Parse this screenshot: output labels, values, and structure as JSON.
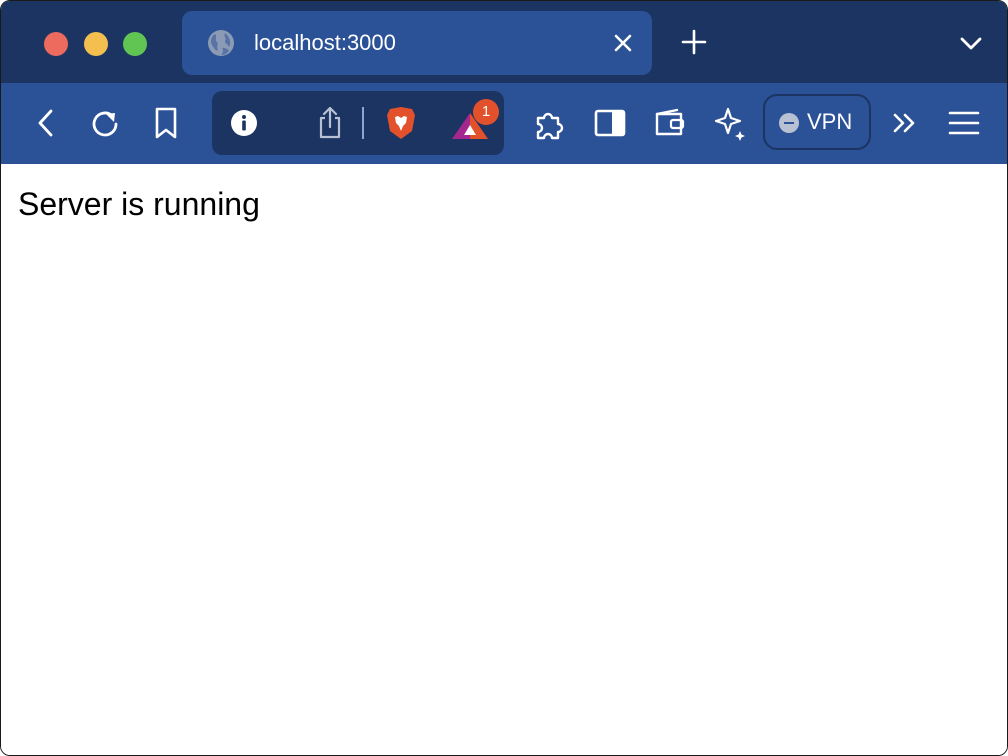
{
  "window": {
    "controls": [
      "close",
      "minimize",
      "maximize"
    ]
  },
  "tab": {
    "title": "localhost:3000",
    "icon": "globe-icon"
  },
  "toolbar": {
    "icons": [
      "back-icon",
      "reload-icon",
      "bookmark-icon",
      "info-icon",
      "share-icon",
      "brave-shields-icon",
      "brave-rewards-icon",
      "extensions-icon",
      "sidebar-icon",
      "wallet-icon",
      "leo-ai-icon",
      "chevrons-right-icon",
      "menu-icon"
    ],
    "rewards_badge": "1",
    "vpn_label": "VPN"
  },
  "colors": {
    "tabstrip": "#1c3461",
    "toolbar": "#2b5196",
    "badge": "#e2512c"
  },
  "page": {
    "message": "Server is running"
  }
}
